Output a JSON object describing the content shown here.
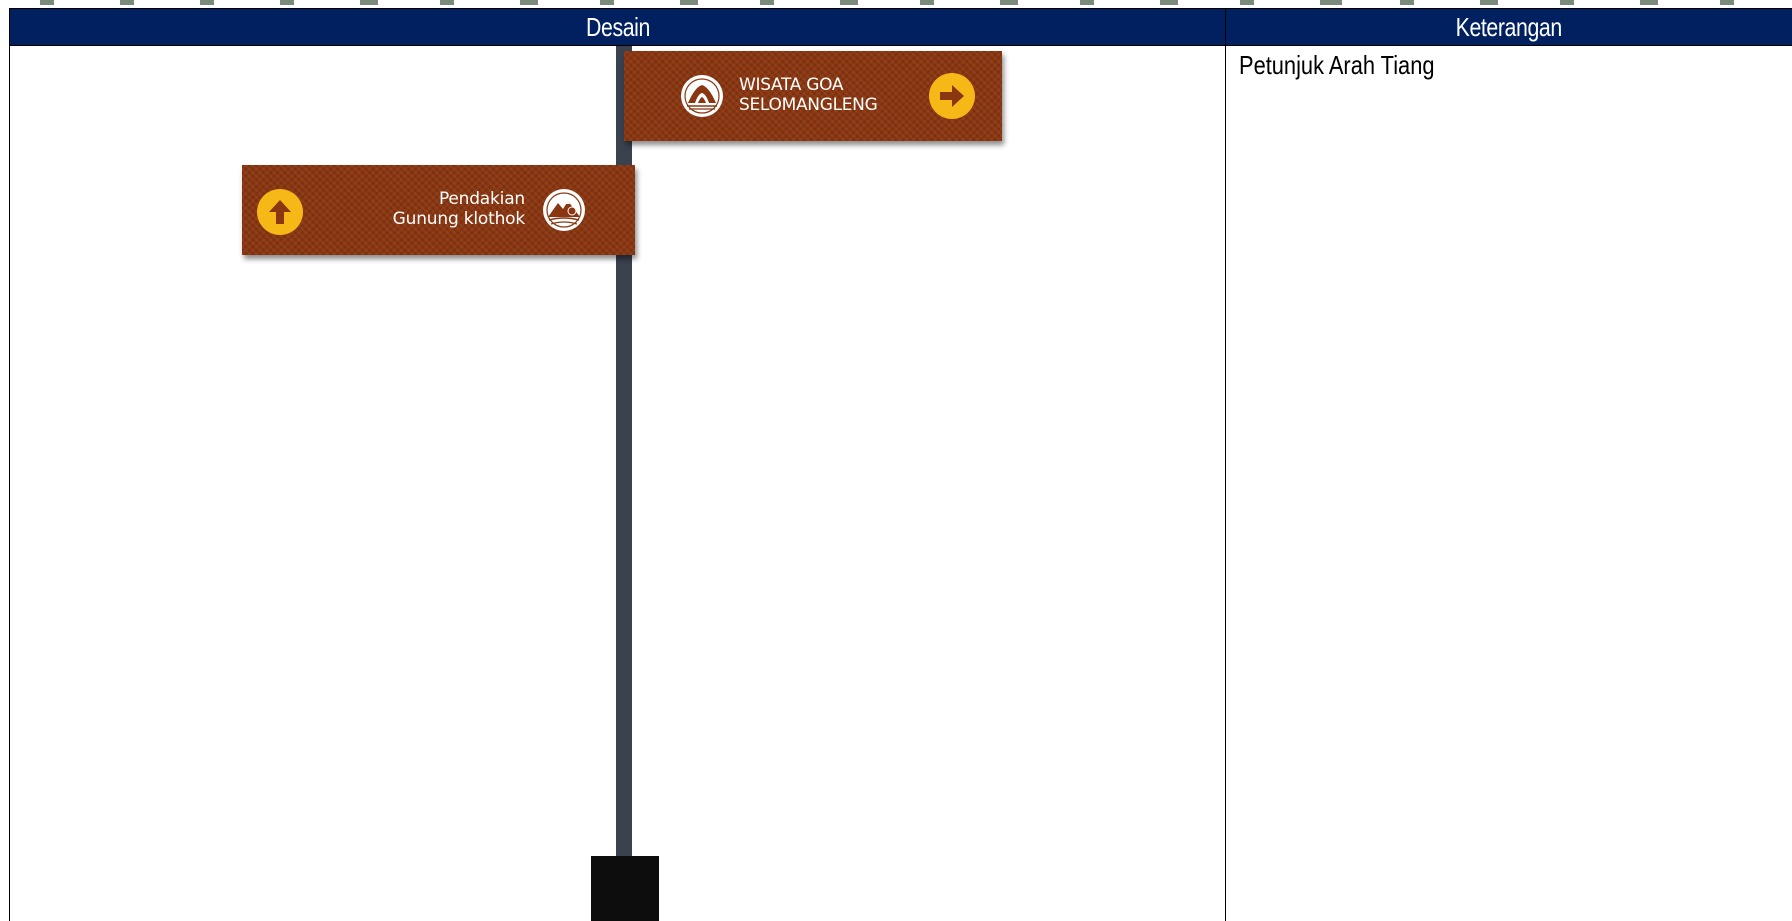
{
  "table": {
    "headers": {
      "design": "Desain",
      "description": "Keterangan"
    },
    "header_color": "#002060"
  },
  "row": {
    "description": "Petunjuk Arah Tiang"
  },
  "signs": [
    {
      "line1": "WISATA GOA",
      "line2": "SELOMANGLENG",
      "arrow": "arrow-right-icon",
      "emblem": "cave-emblem-icon"
    },
    {
      "line1": "Pendakian",
      "line2": "Gunung klothok",
      "arrow": "arrow-up-icon",
      "emblem": "mountain-emblem-icon"
    }
  ],
  "colors": {
    "sign_board": "#8a3610",
    "arrow_circle": "#f6b816",
    "pole": "#3a4250",
    "pole_base": "#0d0d0d"
  }
}
